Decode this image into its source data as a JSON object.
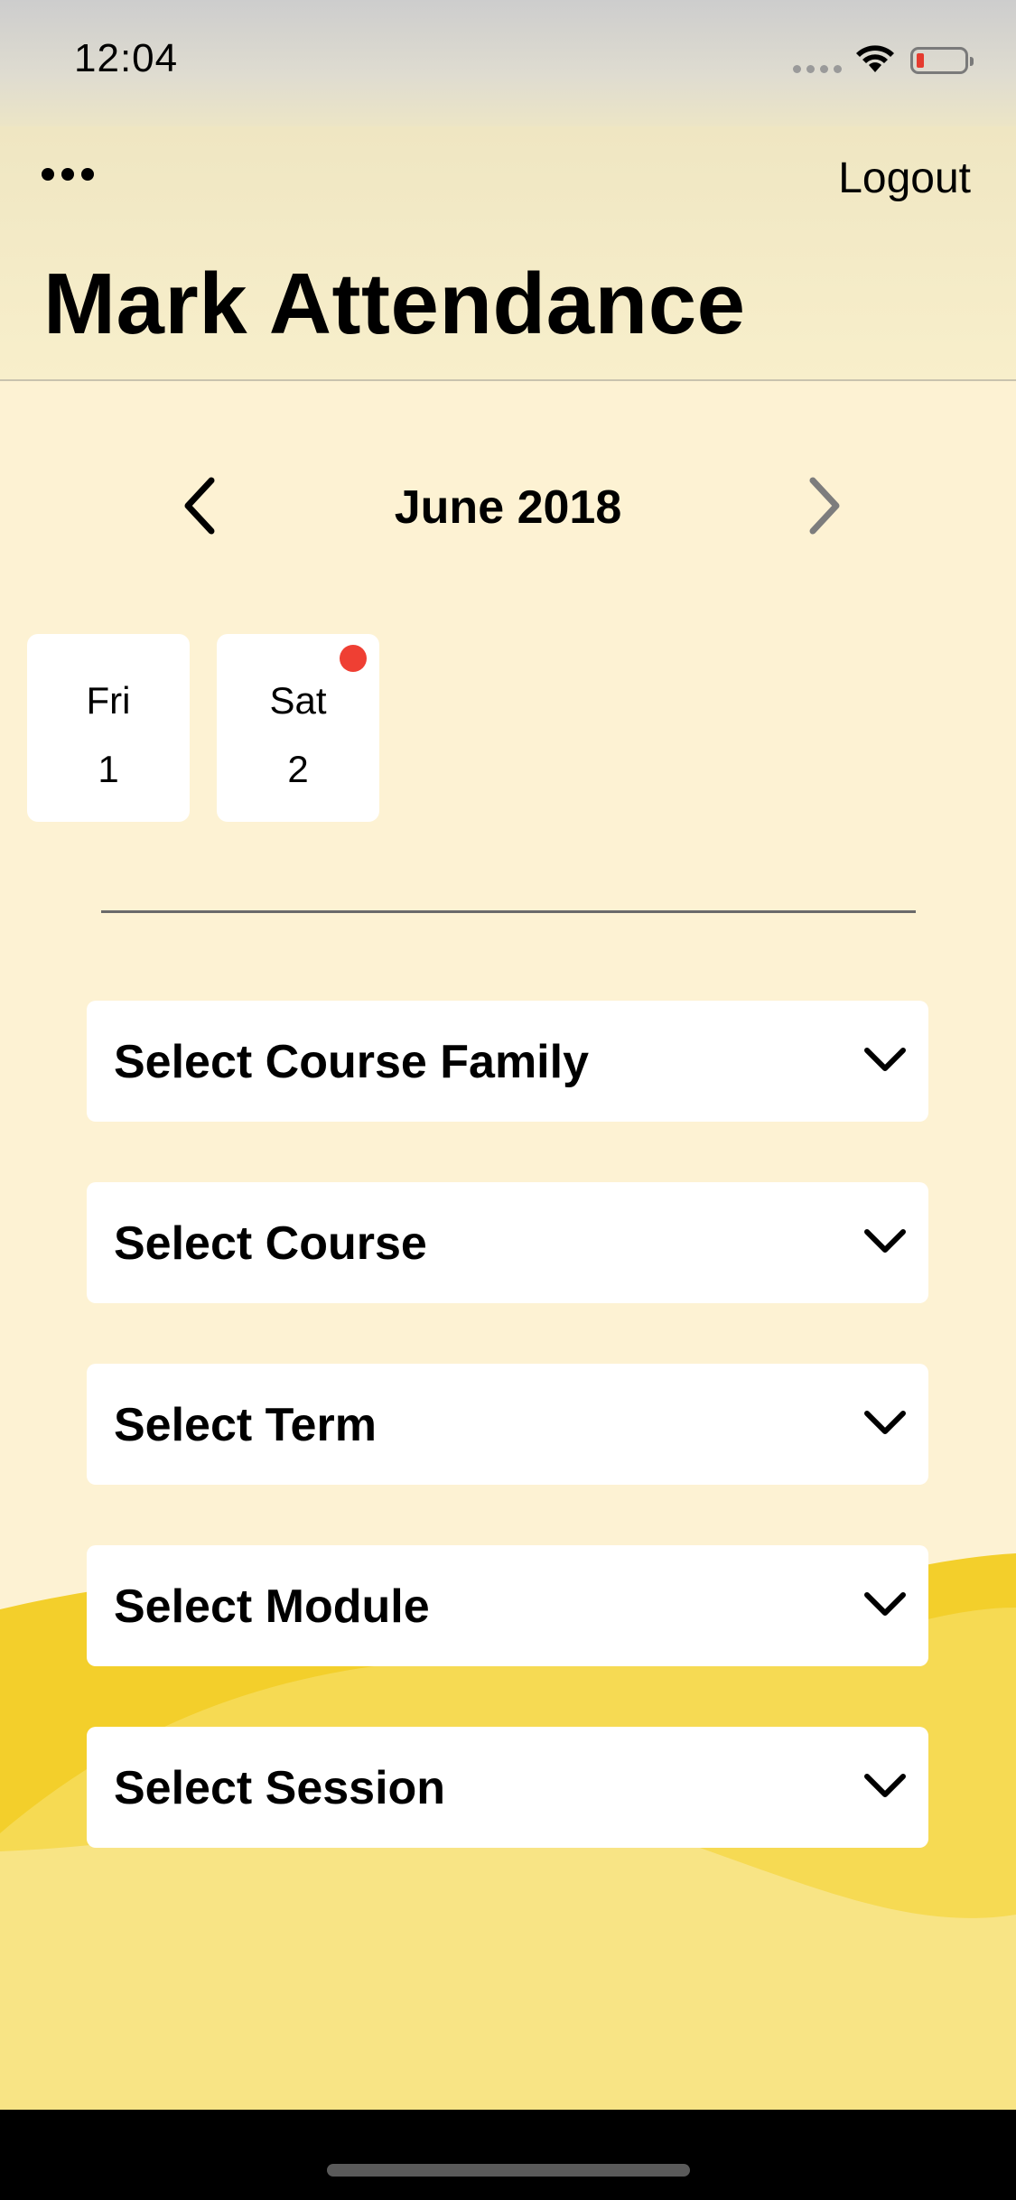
{
  "status_bar": {
    "time": "12:04"
  },
  "header": {
    "menu_icon": "more-icon",
    "logout_label": "Logout",
    "title": "Mark Attendance"
  },
  "calendar": {
    "month_label": "June 2018",
    "days": [
      {
        "dow": "Fri",
        "num": "1",
        "has_badge": false
      },
      {
        "dow": "Sat",
        "num": "2",
        "has_badge": true
      }
    ]
  },
  "selects": [
    {
      "label": "Select Course Family"
    },
    {
      "label": "Select Course"
    },
    {
      "label": "Select Term"
    },
    {
      "label": "Select Module"
    },
    {
      "label": "Select Session"
    }
  ],
  "colors": {
    "background": "#fdf2d3",
    "wave": "#f3cf2b",
    "badge": "#ef3f33"
  }
}
